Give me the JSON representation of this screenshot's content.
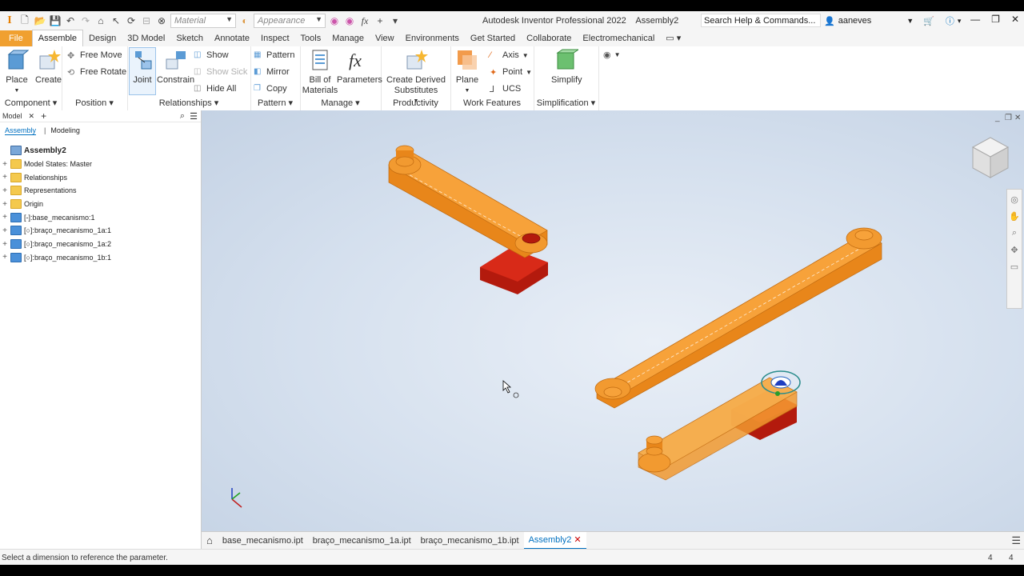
{
  "titlebar": {
    "material_placeholder": "Material",
    "appearance_placeholder": "Appearance",
    "app_title": "Autodesk Inventor Professional 2022",
    "doc_title": "Assembly2",
    "search_placeholder": "Search Help & Commands...",
    "user": "aaneves"
  },
  "tabs": [
    "File",
    "Assemble",
    "Design",
    "3D Model",
    "Sketch",
    "Annotate",
    "Inspect",
    "Tools",
    "Manage",
    "View",
    "Environments",
    "Get Started",
    "Collaborate",
    "Electromechanical"
  ],
  "ribbon": {
    "place": "Place",
    "create": "Create",
    "free_move": "Free Move",
    "free_rotate": "Free Rotate",
    "joint": "Joint",
    "constrain": "Constrain",
    "show": "Show",
    "show_sick": "Show Sick",
    "hide_all": "Hide All",
    "pattern": "Pattern",
    "mirror": "Mirror",
    "copy": "Copy",
    "bom": "Bill of Materials",
    "parameters": "Parameters",
    "derived": "Create Derived Substitutes",
    "plane": "Plane",
    "axis": "Axis",
    "point": "Point",
    "ucs": "UCS",
    "simplify": "Simplify",
    "groups": {
      "component": "Component",
      "position": "Position",
      "relationships": "Relationships",
      "pattern": "Pattern",
      "manage": "Manage",
      "productivity": "Productivity",
      "work_features": "Work Features",
      "simplification": "Simplification"
    }
  },
  "browser": {
    "tab": "Model",
    "sub_assembly": "Assembly",
    "sub_modeling": "Modeling",
    "nodes": [
      "Assembly2",
      "Model States: Master",
      "Relationships",
      "Representations",
      "Origin",
      "[-]:base_mecanismo:1",
      "[○]:braço_mecanismo_1a:1",
      "[○]:braço_mecanismo_1a:2",
      "[○]:braço_mecanismo_1b:1"
    ]
  },
  "doctabs": [
    "base_mecanismo.ipt",
    "braço_mecanismo_1a.ipt",
    "braço_mecanismo_1b.ipt",
    "Assembly2"
  ],
  "status": {
    "message": "Select a dimension to reference the parameter.",
    "count1": "4",
    "count2": "4"
  },
  "colors": {
    "part_orange": "#f0901a",
    "part_red": "#c81e10",
    "accent_blue": "#0070c0",
    "file_tab": "#f0a030"
  }
}
